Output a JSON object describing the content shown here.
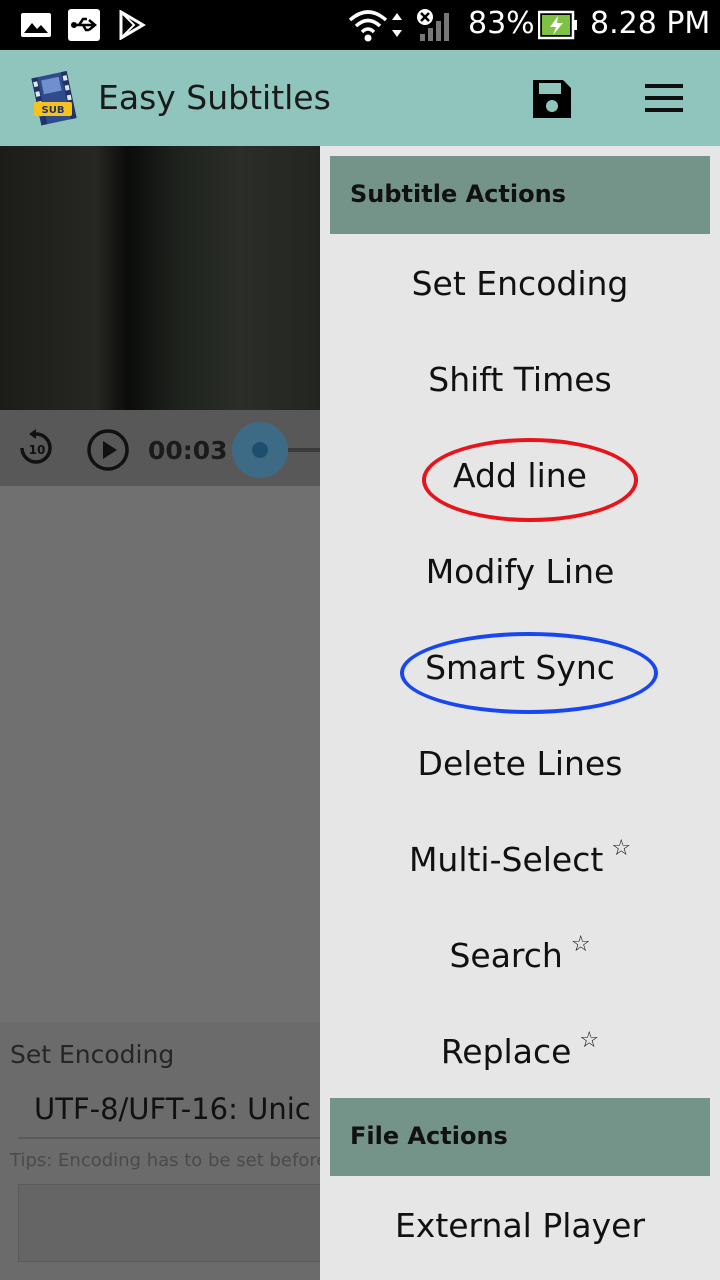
{
  "status_bar": {
    "battery_percent": "83%",
    "time": "8.28 PM"
  },
  "app_bar": {
    "title": "Easy Subtitles",
    "logo_text": "SUB"
  },
  "player": {
    "replay_label": "10",
    "current_time": "00:03"
  },
  "encoding_panel": {
    "label": "Set Encoding",
    "selected_value": "UTF-8/UFT-16: Unic",
    "tip": "Tips: Encoding has to be set before"
  },
  "drawer": {
    "subtitle_actions_header": "Subtitle Actions",
    "items": [
      {
        "label": "Set Encoding",
        "star": ""
      },
      {
        "label": "Shift Times",
        "star": ""
      },
      {
        "label": "Add line",
        "star": ""
      },
      {
        "label": "Modify Line",
        "star": ""
      },
      {
        "label": "Smart Sync",
        "star": ""
      },
      {
        "label": "Delete Lines",
        "star": ""
      },
      {
        "label": "Multi-Select",
        "star": "☆"
      },
      {
        "label": "Search",
        "star": "☆"
      },
      {
        "label": "Replace",
        "star": "☆"
      }
    ],
    "file_actions_header": "File Actions",
    "file_items": [
      {
        "label": "External Player"
      }
    ]
  },
  "colors": {
    "app_bar": "#8fc5bd",
    "section_header": "#749389",
    "drawer_bg": "#e6e6e6",
    "red_annotation": "#e8141b",
    "blue_annotation": "#1747f0"
  }
}
